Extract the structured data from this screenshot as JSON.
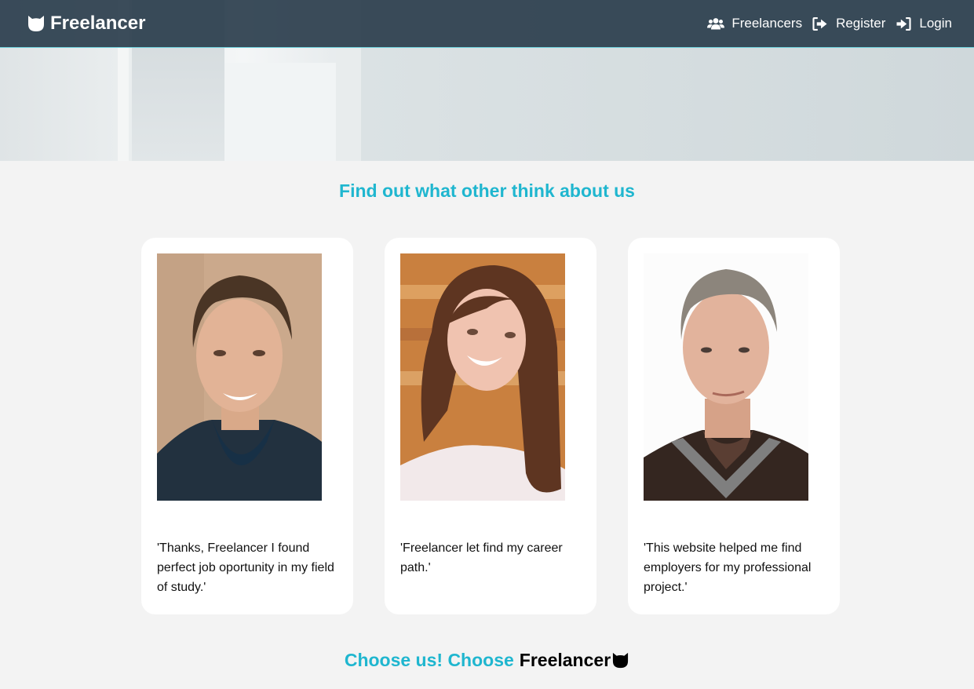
{
  "nav": {
    "brand": "Freelancer",
    "brand_icon": "cat-icon",
    "links": [
      {
        "label": "Freelancers",
        "icon": "users-icon"
      },
      {
        "label": "Register",
        "icon": "sign-out-icon"
      },
      {
        "label": "Login",
        "icon": "sign-in-icon"
      }
    ]
  },
  "testimonials": {
    "title": "Find out what other think about us",
    "cards": [
      {
        "quote": "'Thanks, Freelancer I found perfect job oportunity in my field of study.'"
      },
      {
        "quote": "'Freelancer let find my career path.'"
      },
      {
        "quote": "'This website helped me find employers for my professional project.'"
      }
    ]
  },
  "footer_cta": {
    "lead": "Choose us! Choose",
    "brand": "Freelancer"
  },
  "colors": {
    "accent": "#1fb6cf",
    "navbar": "#2c3e4e",
    "background": "#f3f3f3"
  }
}
